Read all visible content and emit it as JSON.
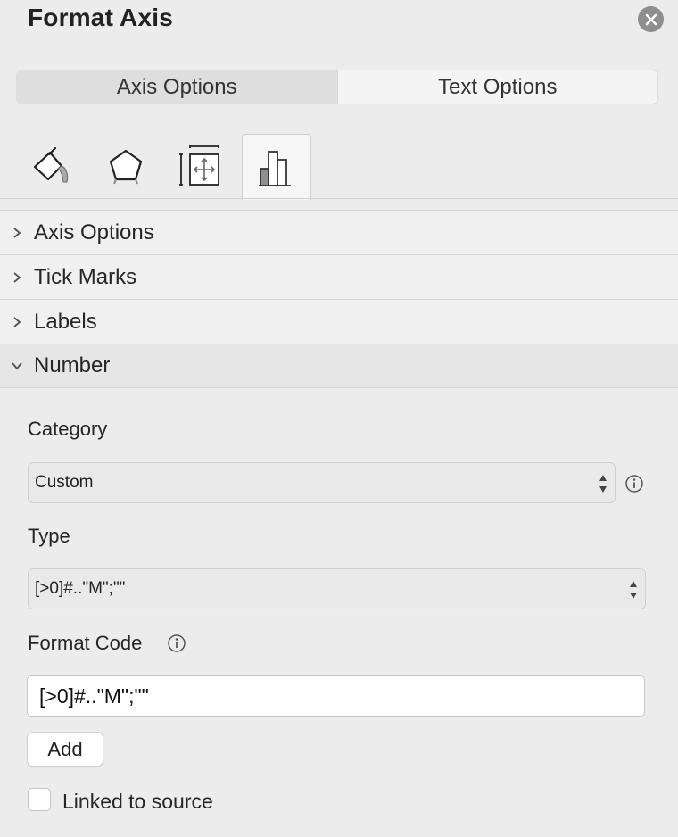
{
  "panel": {
    "title": "Format Axis",
    "close_icon": "close-icon"
  },
  "segmented": {
    "options": [
      "Axis Options",
      "Text Options"
    ],
    "selected": "Axis Options"
  },
  "icon_tabs": [
    {
      "icon": "fill-line-icon"
    },
    {
      "icon": "effects-pentagon-icon"
    },
    {
      "icon": "size-properties-icon"
    },
    {
      "icon": "axis-options-bar-chart-icon",
      "active": true
    }
  ],
  "sections": [
    {
      "label": "Axis Options",
      "expanded": false
    },
    {
      "label": "Tick Marks",
      "expanded": false
    },
    {
      "label": "Labels",
      "expanded": false
    },
    {
      "label": "Number",
      "expanded": true
    }
  ],
  "number": {
    "category_label": "Category",
    "category_value": "Custom",
    "type_label": "Type",
    "type_value": "[>0]#..\"M\";\"\"",
    "format_code_label": "Format Code",
    "format_code_value": "[>0]#..\"M\";\"\"",
    "add_label": "Add",
    "linked_label": "Linked to source",
    "linked_checked": false
  },
  "colors": {
    "background": "#ececec",
    "close_button": "#8e8e8e",
    "accent_bar": "#9a9a9a"
  }
}
